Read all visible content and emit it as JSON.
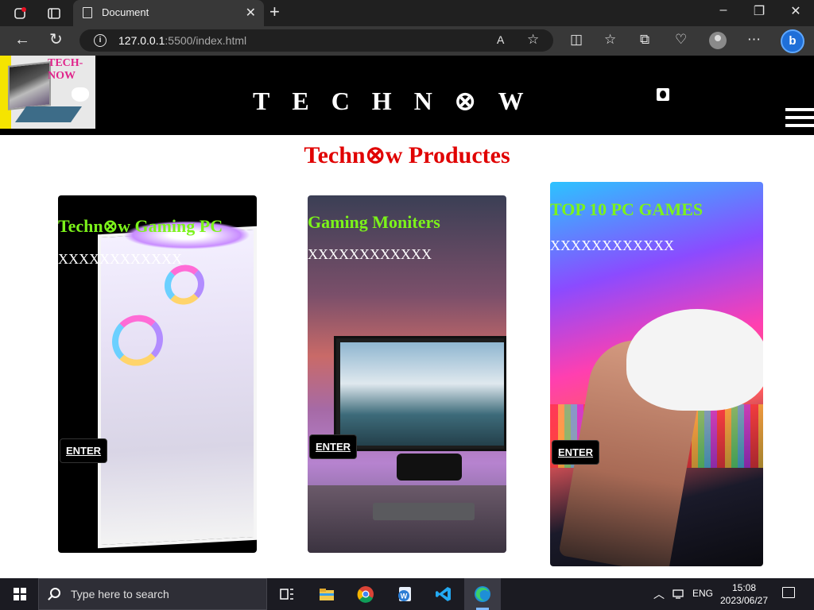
{
  "browser": {
    "tab_title": "Document",
    "tab_close": "✕",
    "new_tab": "+",
    "window_controls": {
      "minimize": "–",
      "restore": "❐",
      "close": "✕"
    },
    "url_host": "127.0.0.1",
    "url_rest": ":5500/index.html",
    "info_glyph": "i",
    "read_aloud": "A",
    "favorite": "☆",
    "nav": {
      "back": "←",
      "refresh": "↻"
    },
    "toolbar": {
      "split": "◫",
      "favorites": "☆",
      "collections": "⧉",
      "health": "♡",
      "more": "⋯"
    },
    "bing": "b"
  },
  "site": {
    "logo_text": "TECH-NOW",
    "title": "TECHN⊗W",
    "heading": "Techn⊗w Productes",
    "colors": {
      "heading": "#e00000",
      "card_title": "#7cf31a",
      "header_bg": "#000000"
    }
  },
  "cards": [
    {
      "title": "Techn⊗w Gaming PC",
      "text": "XXXXXXXXXXXX",
      "button": "ENTER"
    },
    {
      "title": "Gaming Moniters",
      "text": "XXXXXXXXXXXX",
      "button": "ENTER"
    },
    {
      "title": "TOP 10 PC GAMES",
      "text": "XXXXXXXXXXXX",
      "button": "ENTER"
    }
  ],
  "taskbar": {
    "search_placeholder": "Type here to search",
    "language": "ENG",
    "time": "15:08",
    "date": "2023/06/27",
    "apps": [
      "task-view-icon",
      "file-explorer-icon",
      "chrome-icon",
      "word-icon",
      "vscode-icon",
      "edge-icon"
    ]
  }
}
